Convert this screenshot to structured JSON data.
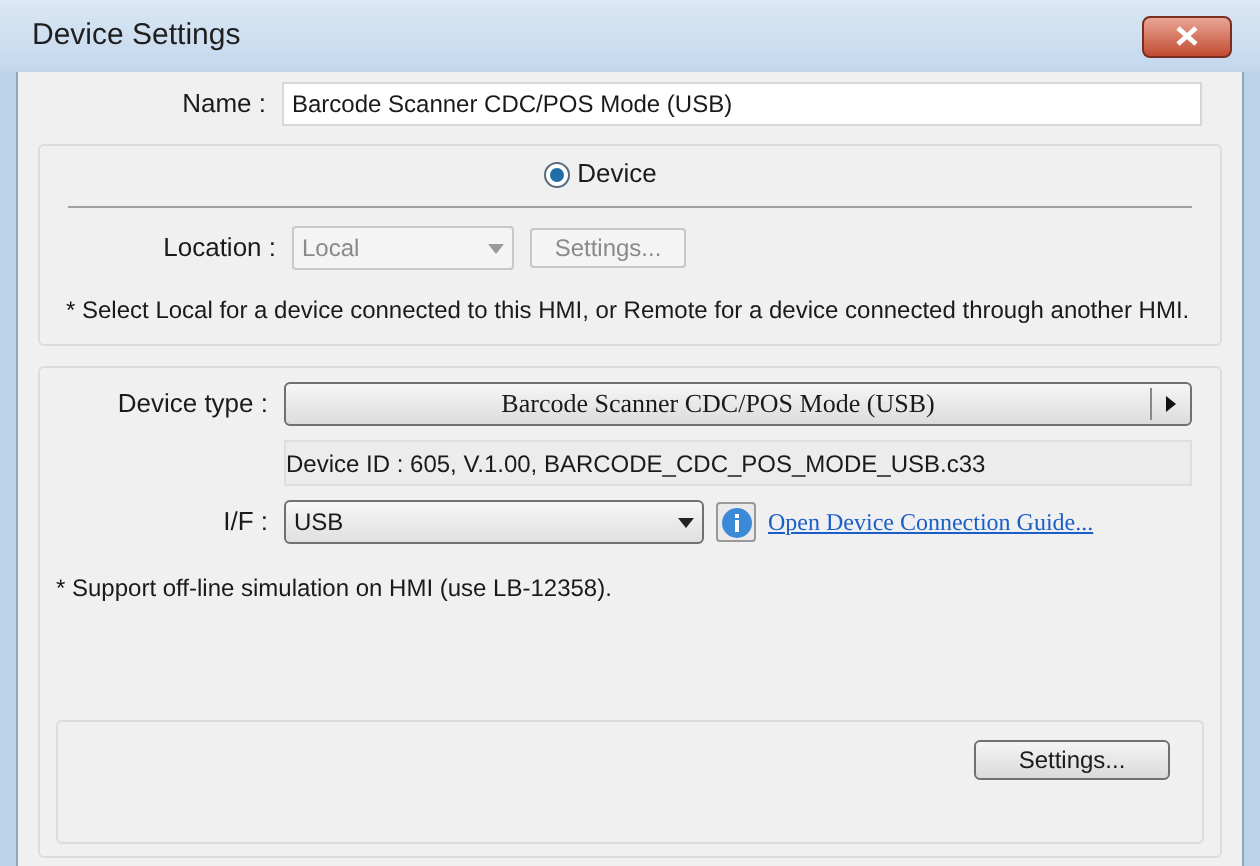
{
  "window": {
    "title": "Device Settings"
  },
  "name": {
    "label": "Name :",
    "value": "Barcode Scanner CDC/POS Mode (USB)"
  },
  "mode": {
    "label": "Device",
    "selected": true
  },
  "location": {
    "label": "Location :",
    "value": "Local",
    "disabled": true,
    "settings_button": {
      "label": "Settings...",
      "disabled": true
    }
  },
  "location_note": "* Select Local for a device connected to this HMI, or Remote for a device connected through another HMI.",
  "device_type": {
    "label": "Device type :",
    "value": "Barcode Scanner CDC/POS Mode (USB)"
  },
  "device_id": "Device ID : 605, V.1.00, BARCODE_CDC_POS_MODE_USB.c33",
  "interface": {
    "label": "I/F :",
    "value": "USB",
    "guide_link": "Open Device Connection Guide..."
  },
  "simulation_note": "* Support off-line simulation on HMI (use LB-12358).",
  "settings_button": {
    "label": "Settings..."
  }
}
